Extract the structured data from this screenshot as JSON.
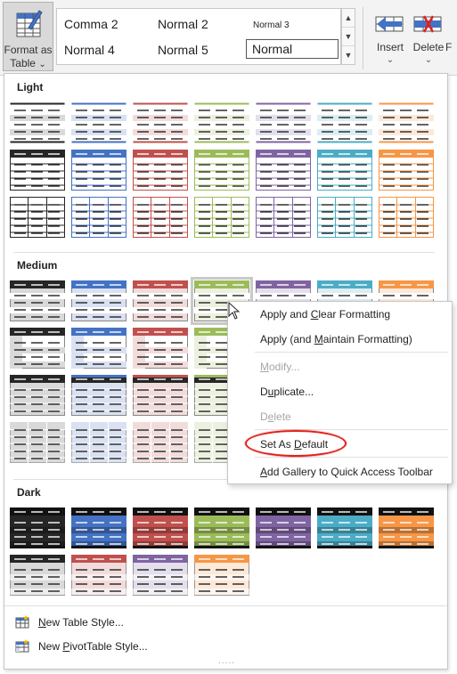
{
  "ribbon": {
    "format_as_table": {
      "line1": "Format as",
      "line2": "Table",
      "chevron": "⌄"
    },
    "cell_styles": {
      "row1": [
        "Comma 2",
        "Normal 2",
        "Normal 3"
      ],
      "row2": [
        "Normal 4",
        "Normal 5",
        "Normal"
      ]
    },
    "insert": {
      "label": "Insert",
      "chevron": "⌄"
    },
    "delete": {
      "label": "Delete",
      "chevron": "⌄"
    },
    "format_partial": {
      "label": "F"
    }
  },
  "gallery": {
    "sections": [
      {
        "title": "Light"
      },
      {
        "title": "Medium"
      },
      {
        "title": "Dark"
      }
    ],
    "colors": [
      "#262626",
      "#4472c4",
      "#c0504d",
      "#9bbb59",
      "#8064a2",
      "#4bacc6",
      "#f79646"
    ],
    "light_colors": [
      "#d9d9d9",
      "#d9e1f2",
      "#f2dcdb",
      "#ebf1de",
      "#e4dfec",
      "#daeef3",
      "#fde9d9"
    ],
    "links": [
      {
        "label_pre": "",
        "label_u": "N",
        "label_post": "ew Table Style..."
      },
      {
        "label_pre": "New ",
        "label_u": "P",
        "label_post": "ivotTable Style..."
      }
    ],
    "grip": "....."
  },
  "context_menu": {
    "items": [
      {
        "pre": "Apply and ",
        "u": "C",
        "post": "lear Formatting",
        "enabled": true
      },
      {
        "pre": "Apply (and ",
        "u": "M",
        "post": "aintain Formatting)",
        "enabled": true
      },
      {
        "pre": "",
        "u": "M",
        "post": "odify...",
        "enabled": false
      },
      {
        "pre": "D",
        "u": "u",
        "post": "plicate...",
        "enabled": true
      },
      {
        "pre": "D",
        "u": "e",
        "post": "lete",
        "enabled": false
      },
      {
        "pre": "Set As ",
        "u": "D",
        "post": "efault",
        "enabled": true
      },
      {
        "pre": "",
        "u": "A",
        "post": "dd Gallery to Quick Access Toolbar",
        "enabled": true
      }
    ]
  }
}
